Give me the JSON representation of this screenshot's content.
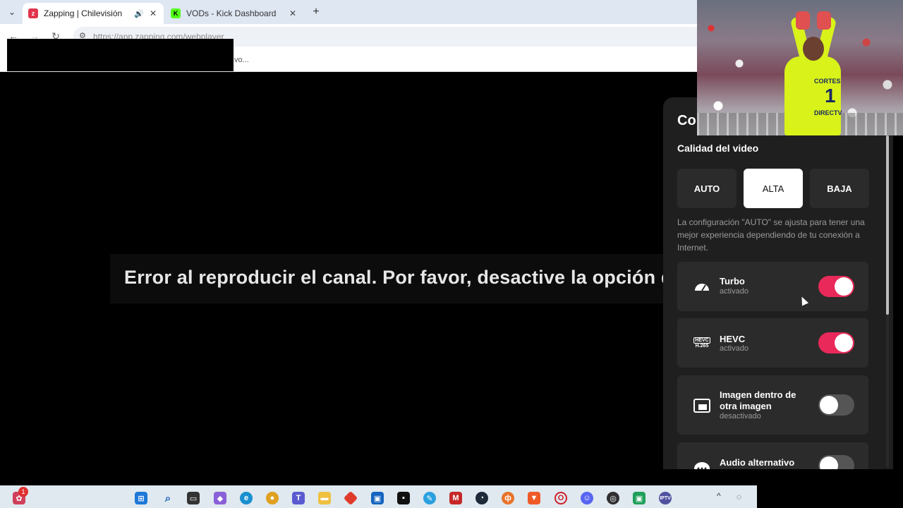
{
  "browser": {
    "tabs": [
      {
        "title": "Zapping | Chilevisión",
        "favicon": "zapping-favicon",
        "active": true,
        "audio": true
      },
      {
        "title": "VODs - Kick Dashboard",
        "favicon": "kick-favicon",
        "active": false
      }
    ],
    "tab_menu_icon": "⌄",
    "new_tab_icon": "+",
    "close_icon": "✕",
    "audio_icon": "🔊",
    "url": "https://app.zapping.com/webplayer",
    "bookmark_fragment": "vo..."
  },
  "player": {
    "error_message": "Error al reproducir el canal. Por favor, desactive la opción de HEVC."
  },
  "settings_panel": {
    "title": "Co",
    "quality_section_label": "Calidad del video",
    "quality_options": [
      "AUTO",
      "ALTA",
      "BAJA"
    ],
    "quality_selected": "ALTA",
    "quality_description": "La configuración \"AUTO\" se ajusta para tener una mejor experiencia dependiendo de tu conexión a Internet.",
    "options": [
      {
        "name": "Turbo",
        "status": "activado",
        "enabled": true,
        "icon": "speedometer-icon"
      },
      {
        "name": "HEVC",
        "status": "activado",
        "enabled": true,
        "icon": "hevc-icon",
        "icon_label_top": "HEVC",
        "icon_label_bottom": "H.265"
      },
      {
        "name": "Imagen dentro de otra imagen",
        "status": "desactivado",
        "enabled": false,
        "icon": "picture-in-picture-icon"
      },
      {
        "name": "Audio alternativo",
        "status": "",
        "enabled": false,
        "icon": "chat-bubble-icon"
      }
    ],
    "accent_color": "#e8295a"
  },
  "webcam_overlay": {
    "jersey_name": "CORTES",
    "jersey_number": "1",
    "sponsor": "DIRECTV"
  },
  "taskbar": {
    "notification_count": "1",
    "icons": [
      "copilot-icon",
      "windows-start-icon",
      "search-icon",
      "task-view-icon",
      "copilot-app-icon",
      "edge-icon",
      "chrome-icon",
      "teams-icon",
      "file-explorer-icon",
      "app-red-icon",
      "store-icon",
      "app-black-icon",
      "paint-icon",
      "mcafee-icon",
      "speedtest-icon",
      "firefox-icon",
      "brave-icon",
      "opera-icon",
      "discord-icon",
      "obs-icon",
      "app-green-icon",
      "iptv-icon"
    ],
    "tray_up": "^"
  }
}
